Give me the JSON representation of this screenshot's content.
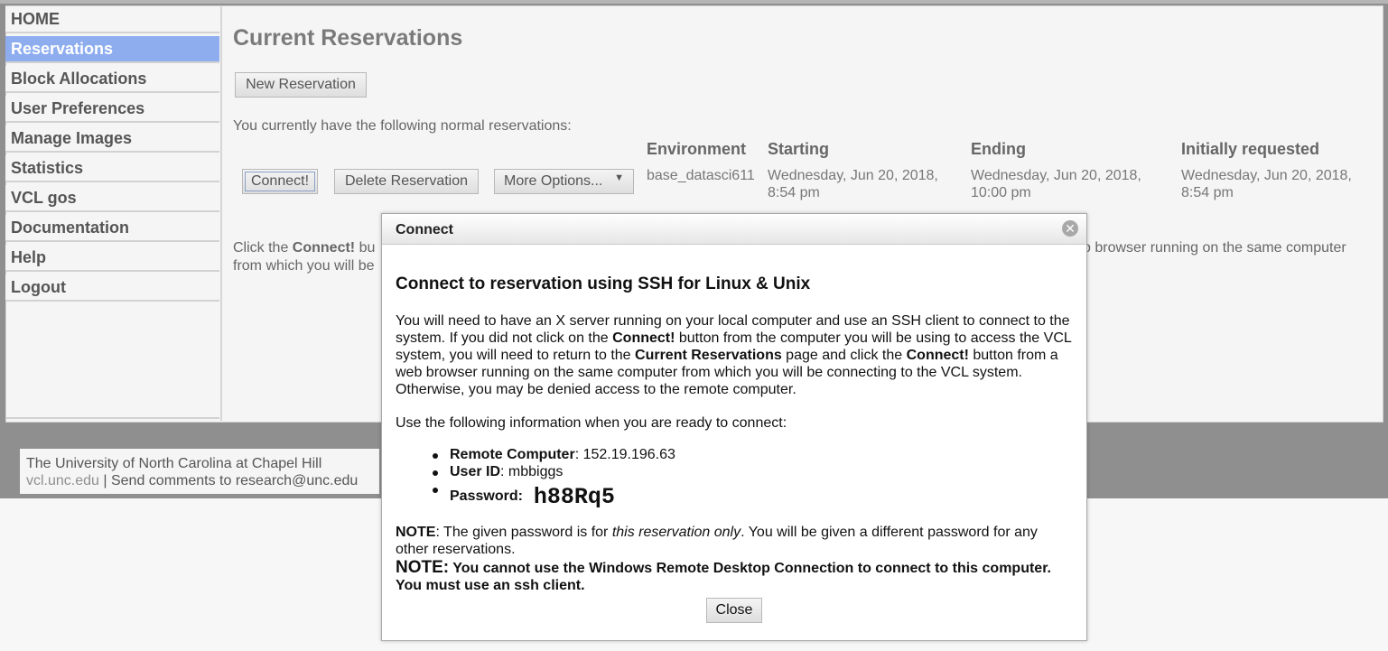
{
  "sidebar": {
    "items": [
      {
        "label": "HOME",
        "active": false
      },
      {
        "label": "Reservations",
        "active": true
      },
      {
        "label": "Block Allocations",
        "active": false
      },
      {
        "label": "User Preferences",
        "active": false
      },
      {
        "label": "Manage Images",
        "active": false
      },
      {
        "label": "Statistics",
        "active": false
      },
      {
        "label": "VCL gos",
        "active": false
      },
      {
        "label": "Documentation",
        "active": false
      },
      {
        "label": "Help",
        "active": false
      },
      {
        "label": "Logout",
        "active": false
      }
    ]
  },
  "main": {
    "title": "Current Reservations",
    "new_reservation_label": "New Reservation",
    "intro": "You currently have the following normal reservations:",
    "columns": [
      "Environment",
      "Starting",
      "Ending",
      "Initially requested"
    ],
    "reservation": {
      "connect_label": "Connect!",
      "delete_label": "Delete Reservation",
      "more_options_label": "More Options...",
      "environment": "base_datasci611",
      "starting_date": "Wednesday, Jun 20, 2018,",
      "starting_time": "8:54 pm",
      "ending_date": "Wednesday, Jun 20, 2018,",
      "ending_time": "10:00 pm",
      "requested_date": "Wednesday, Jun 20, 2018,",
      "requested_time": "8:54 pm"
    },
    "click_text_a": "Click the ",
    "click_text_bold": "Connect!",
    "click_text_b": " bu",
    "click_text_right": "b browser running on the same computer",
    "click_text_line2": "from which you will be"
  },
  "footer": {
    "institution": "The University of North Carolina at Chapel Hill",
    "link": "vcl.unc.edu",
    "separator": " | ",
    "comments": "Send comments to research@unc.edu"
  },
  "dialog": {
    "title": "Connect",
    "heading": "Connect to reservation using SSH for Linux & Unix",
    "para1_a": "You will need to have an X server running on your local computer and use an SSH client to connect to the system. If you did not click on the ",
    "para1_b": "Connect!",
    "para1_c": " button from the computer you will be using to access the VCL system, you will need to return to the ",
    "para1_d": "Current Reservations",
    "para1_e": " page and click the ",
    "para1_f": "Connect!",
    "para1_g": " button from a web browser running on the same computer from which you will be connecting to the VCL system. Otherwise, you may be denied access to the remote computer.",
    "para2": "Use the following information when you are ready to connect:",
    "remote_computer_label": "Remote Computer",
    "remote_computer_value": ": 152.19.196.63",
    "user_id_label": "User ID",
    "user_id_value": ": mbbiggs",
    "password_label": "Password:",
    "password_value": "h88Rq5",
    "note1_label": "NOTE",
    "note1_a": ": The given password is for ",
    "note1_italic": "this reservation only",
    "note1_b": ". You will be given a different password for any other reservations.",
    "note2_label": "NOTE:",
    "note2_text": " You cannot use the Windows Remote Desktop Connection to connect to this computer. You must use an ssh client.",
    "close_label": "Close"
  },
  "colors": {
    "active_nav": "#8eadef",
    "page_background": "#8f8f8f",
    "panel_background": "#f5f5f5"
  }
}
